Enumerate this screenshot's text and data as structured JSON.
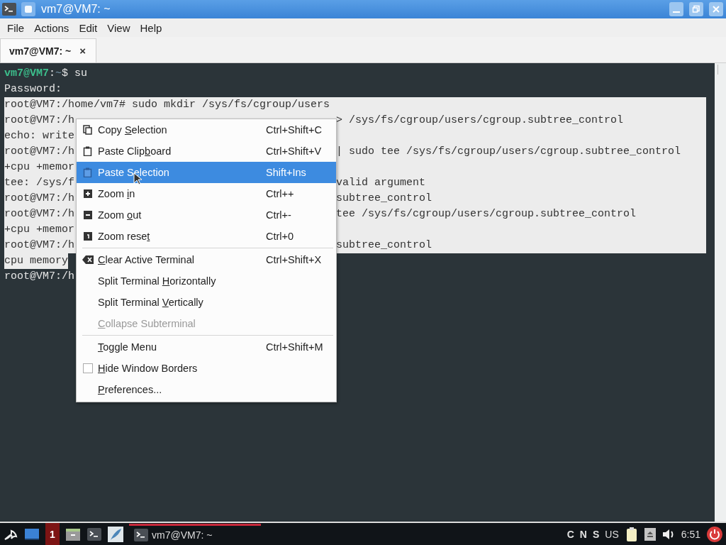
{
  "window": {
    "title": "vm7@VM7: ~"
  },
  "menubar": [
    "File",
    "Actions",
    "Edit",
    "View",
    "Help"
  ],
  "tabs": [
    {
      "label": "vm7@VM7: ~",
      "selected": true,
      "close": "×"
    }
  ],
  "terminal": {
    "lines": [
      {
        "selected": false,
        "segments": [
          {
            "kind": "user",
            "text": "vm7@VM7"
          },
          {
            "kind": "plain",
            "text": ":"
          },
          {
            "kind": "path",
            "text": "~"
          },
          {
            "kind": "plain",
            "text": "$ su"
          }
        ]
      },
      {
        "selected": false,
        "segments": [
          {
            "kind": "plain",
            "text": "Password:"
          }
        ]
      },
      {
        "selected": true,
        "segments": [
          {
            "kind": "plain",
            "text": "root@VM7:/home/vm7# sudo mkdir /sys/fs/cgroup/users"
          }
        ]
      },
      {
        "selected": true,
        "segments": [
          {
            "kind": "plain",
            "text": "root@VM7:/h"
          }
        ],
        "right": "> /sys/fs/cgroup/users/cgroup.subtree_control"
      },
      {
        "selected": true,
        "segments": [
          {
            "kind": "plain",
            "text": "echo: write"
          }
        ]
      },
      {
        "selected": true,
        "segments": [
          {
            "kind": "plain",
            "text": "root@VM7:/h"
          }
        ],
        "right": "| sudo tee /sys/fs/cgroup/users/cgroup.subtree_control"
      },
      {
        "selected": true,
        "segments": [
          {
            "kind": "plain",
            "text": "+cpu +memor"
          }
        ]
      },
      {
        "selected": true,
        "segments": [
          {
            "kind": "plain",
            "text": "tee: /sys/f"
          }
        ],
        "right": "valid argument"
      },
      {
        "selected": true,
        "segments": [
          {
            "kind": "plain",
            "text": "root@VM7:/h"
          }
        ],
        "right": "subtree_control"
      },
      {
        "selected": true,
        "segments": [
          {
            "kind": "plain",
            "text": "root@VM7:/h"
          }
        ],
        "right": "tee /sys/fs/cgroup/users/cgroup.subtree_control"
      },
      {
        "selected": true,
        "segments": [
          {
            "kind": "plain",
            "text": "+cpu +memor"
          }
        ]
      },
      {
        "selected": true,
        "segments": [
          {
            "kind": "plain",
            "text": "root@VM7:/h"
          }
        ],
        "right": "subtree_control"
      },
      {
        "selected": true,
        "segments": [
          {
            "kind": "plain",
            "text": "cpu memory"
          }
        ]
      },
      {
        "selected": false,
        "segments": [
          {
            "kind": "plain",
            "text": "root@VM7:/h"
          }
        ]
      }
    ]
  },
  "context_menu": {
    "items": [
      {
        "kind": "action",
        "label": {
          "pre": "Copy ",
          "key": "S",
          "post": "election"
        },
        "shortcut": "Ctrl+Shift+C",
        "selected": false,
        "disabled": false
      },
      {
        "kind": "action",
        "label": {
          "pre": "Paste Clip",
          "key": "b",
          "post": "oard"
        },
        "shortcut": "Ctrl+Shift+V",
        "selected": false,
        "disabled": false
      },
      {
        "kind": "action",
        "label": {
          "pre": "Paste S",
          "key": "e",
          "post": "lection"
        },
        "shortcut": "Shift+Ins",
        "selected": true,
        "disabled": false
      },
      {
        "kind": "action",
        "label": {
          "pre": "Zoom ",
          "key": "i",
          "post": "n"
        },
        "shortcut": "Ctrl++",
        "selected": false,
        "disabled": false
      },
      {
        "kind": "action",
        "label": {
          "pre": "Zoom ",
          "key": "o",
          "post": "ut"
        },
        "shortcut": "Ctrl+-",
        "selected": false,
        "disabled": false
      },
      {
        "kind": "action",
        "label": {
          "pre": "Zoom rese",
          "key": "t"
        },
        "shortcut": "Ctrl+0",
        "selected": false,
        "disabled": false
      },
      {
        "kind": "separator"
      },
      {
        "kind": "action",
        "label": {
          "key": "C",
          "post": "lear Active Terminal"
        },
        "shortcut": "Ctrl+Shift+X",
        "selected": false,
        "disabled": false
      },
      {
        "kind": "action",
        "label": {
          "pre": "Split Terminal ",
          "key": "H",
          "post": "orizontally"
        },
        "selected": false,
        "disabled": false
      },
      {
        "kind": "action",
        "label": {
          "pre": "Split Terminal ",
          "key": "V",
          "post": "ertically"
        },
        "selected": false,
        "disabled": false
      },
      {
        "kind": "action",
        "label": {
          "key": "C",
          "post": "ollapse Subterminal"
        },
        "selected": false,
        "disabled": true
      },
      {
        "kind": "separator"
      },
      {
        "kind": "action",
        "label": {
          "key": "T",
          "post": "oggle Menu"
        },
        "shortcut": "Ctrl+Shift+M",
        "selected": false,
        "disabled": false
      },
      {
        "kind": "checkbox",
        "label": {
          "key": "H",
          "post": "ide Window Borders"
        },
        "checked": false,
        "selected": false,
        "disabled": false
      },
      {
        "kind": "action",
        "label": {
          "key": "P",
          "post": "references..."
        },
        "selected": false,
        "disabled": false
      }
    ]
  },
  "taskbar": {
    "workspace": "1",
    "tasks": [
      {
        "label": "vm7@VM7: ~",
        "selected": true
      }
    ],
    "indicators": [
      "C",
      "N",
      "S"
    ],
    "layout": "US",
    "clock": "6:51"
  }
}
